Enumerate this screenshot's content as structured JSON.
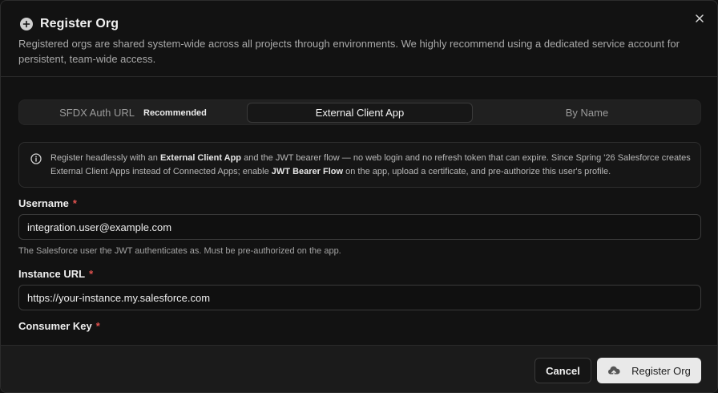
{
  "dialog": {
    "title": "Register Org",
    "description": "Registered orgs are shared system-wide across all projects through environments. We highly recommend using a dedicated service account for persistent, team-wide access.",
    "close_icon": "close-icon",
    "title_icon": "plus-circle-icon"
  },
  "tabs": [
    {
      "label": "SFDX Auth URL",
      "badge": "Recommended",
      "active": false
    },
    {
      "label": "External Client App",
      "active": true
    },
    {
      "label": "By Name",
      "active": false
    }
  ],
  "info": {
    "icon": "info-icon",
    "p1": "Register headlessly with an ",
    "b1": "External Client App",
    "p2": " and the JWT bearer flow — no web login and no refresh token that can expire. Since Spring '26 Salesforce creates External Client Apps instead of Connected Apps; enable ",
    "b2": "JWT Bearer Flow",
    "p3": " on the app, upload a certificate, and pre-authorize this user's profile."
  },
  "fields": {
    "username": {
      "label": "Username",
      "required": "*",
      "value": "integration.user@example.com",
      "hint": "The Salesforce user the JWT authenticates as. Must be pre-authorized on the app."
    },
    "instance_url": {
      "label": "Instance URL",
      "required": "*",
      "value": "https://your-instance.my.salesforce.com"
    },
    "consumer_key": {
      "label": "Consumer Key",
      "required": "*"
    }
  },
  "footer": {
    "cancel_label": "Cancel",
    "register_label": "Register Org",
    "register_icon": "cloud-upload-icon"
  },
  "colors": {
    "background": "#121212",
    "required": "#e2524f",
    "primary_button": "#e9e9e9"
  }
}
